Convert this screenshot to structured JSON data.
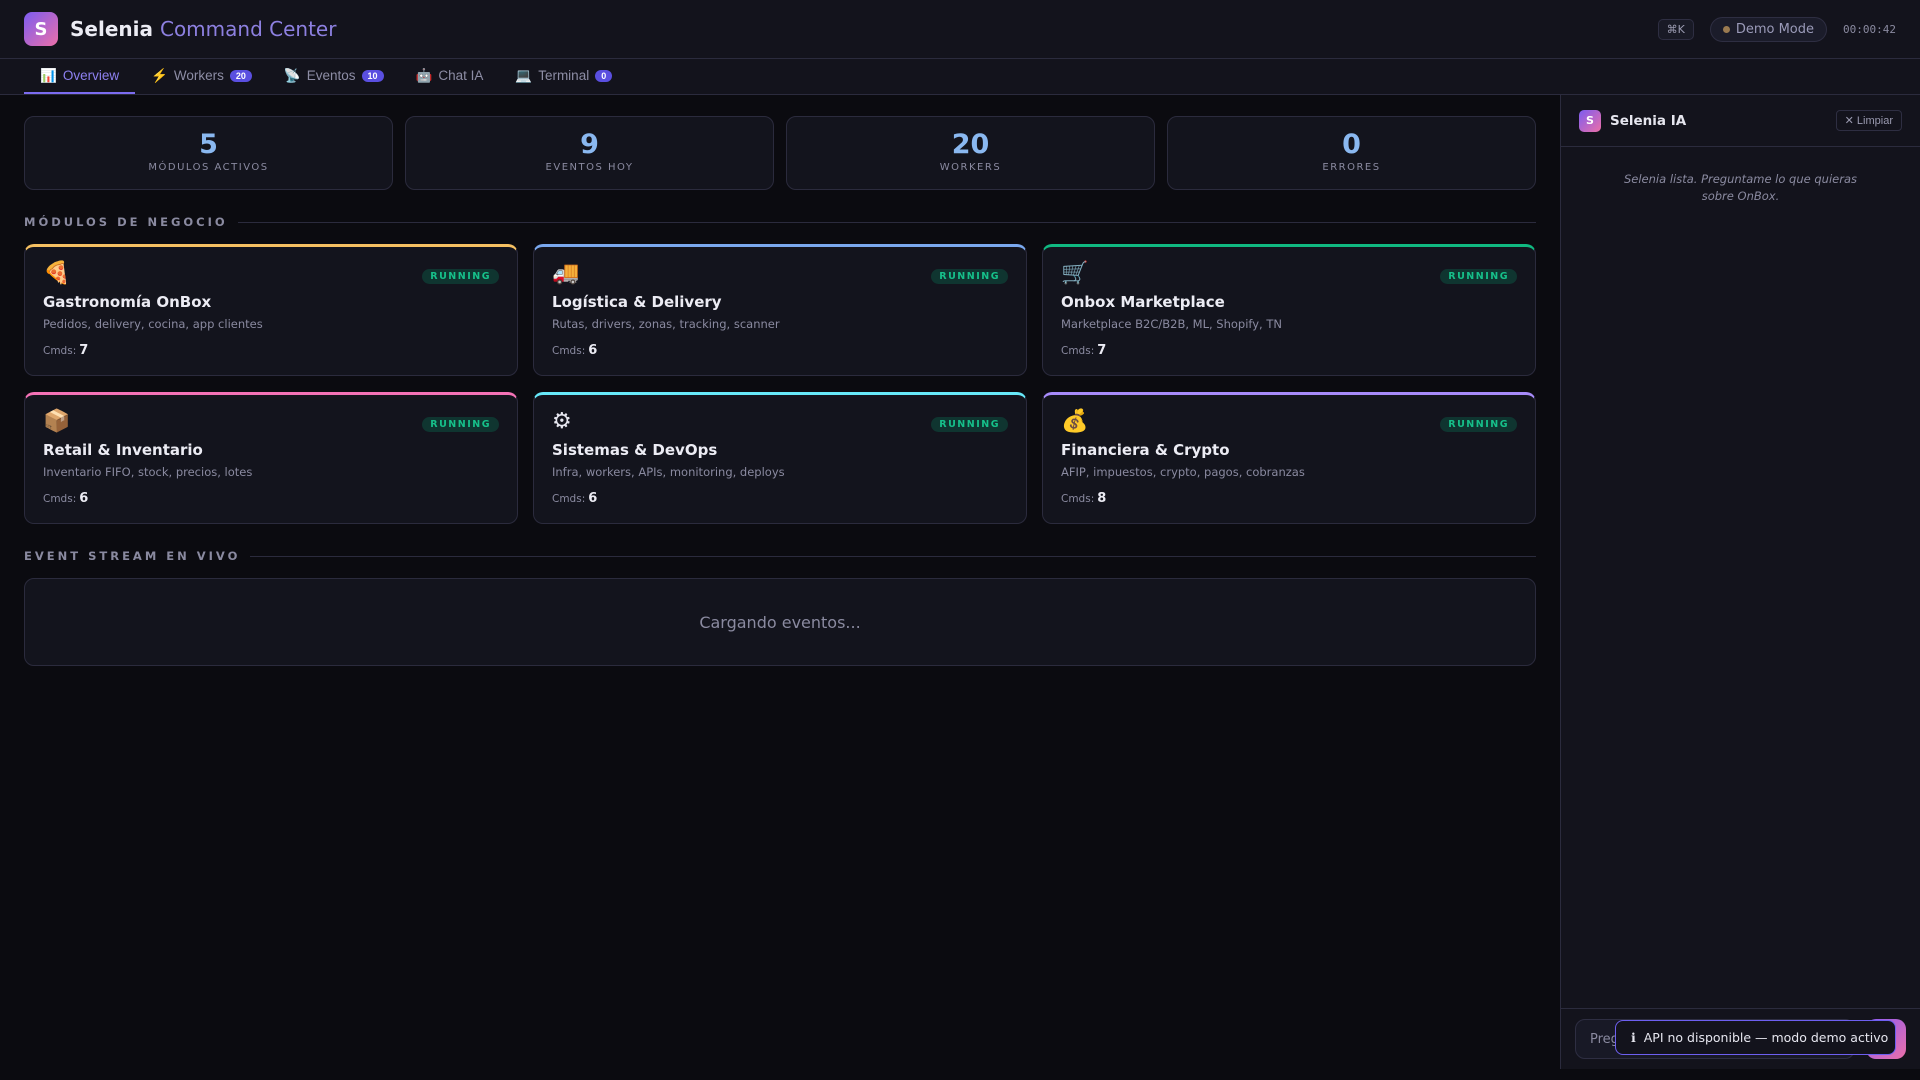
{
  "header": {
    "logo_letter": "S",
    "brand": "Selenia",
    "subtitle": "Command Center",
    "shortcut": "⌘K",
    "mode": "Demo Mode",
    "clock": "00:00:42"
  },
  "tabs": [
    {
      "icon": "📊",
      "label": "Overview"
    },
    {
      "icon": "⚡",
      "label": "Workers",
      "badge": "20"
    },
    {
      "icon": "📡",
      "label": "Eventos",
      "badge": "10"
    },
    {
      "icon": "🤖",
      "label": "Chat IA"
    },
    {
      "icon": "💻",
      "label": "Terminal",
      "badge": "0"
    }
  ],
  "stats": [
    {
      "value": "5",
      "label": "MÓDULOS ACTIVOS"
    },
    {
      "value": "9",
      "label": "EVENTOS HOY"
    },
    {
      "value": "20",
      "label": "WORKERS"
    },
    {
      "value": "0",
      "label": "ERRORES"
    }
  ],
  "modules_title": "MÓDULOS DE NEGOCIO",
  "cmds_label": "Cmds:",
  "modules": [
    {
      "icon": "🍕",
      "status": "RUNNING",
      "title": "Gastronomía OnBox",
      "desc": "Pedidos, delivery, cocina, app clientes",
      "cmds": "7",
      "color": "#f5c062"
    },
    {
      "icon": "🚚",
      "status": "RUNNING",
      "title": "Logística & Delivery",
      "desc": "Rutas, drivers, zonas, tracking, scanner",
      "cmds": "6",
      "color": "#7aa8ee"
    },
    {
      "icon": "🛒",
      "status": "RUNNING",
      "title": "Onbox Marketplace",
      "desc": "Marketplace B2C/B2B, ML, Shopify, TN",
      "cmds": "7",
      "color": "#10b981"
    },
    {
      "icon": "📦",
      "status": "RUNNING",
      "title": "Retail & Inventario",
      "desc": "Inventario FIFO, stock, precios, lotes",
      "cmds": "6",
      "color": "#f472b6"
    },
    {
      "icon": "⚙",
      "status": "RUNNING",
      "title": "Sistemas & DevOps",
      "desc": "Infra, workers, APIs, monitoring, deploys",
      "cmds": "6",
      "color": "#67e8f9"
    },
    {
      "icon": "💰",
      "status": "RUNNING",
      "title": "Financiera & Crypto",
      "desc": "AFIP, impuestos, crypto, pagos, cobranzas",
      "cmds": "8",
      "color": "#a78bfa"
    }
  ],
  "events_title": "EVENT STREAM EN VIVO",
  "events_loading": "Cargando eventos...",
  "chat": {
    "logo_letter": "S",
    "title": "Selenia IA",
    "clear": "✕ Limpiar",
    "hint": "Selenia lista. Preguntame lo que quieras sobre OnBox.",
    "placeholder": "Preguntá algo..."
  },
  "toast": {
    "icon": "ℹ",
    "text": "API no disponible — modo demo activo"
  }
}
